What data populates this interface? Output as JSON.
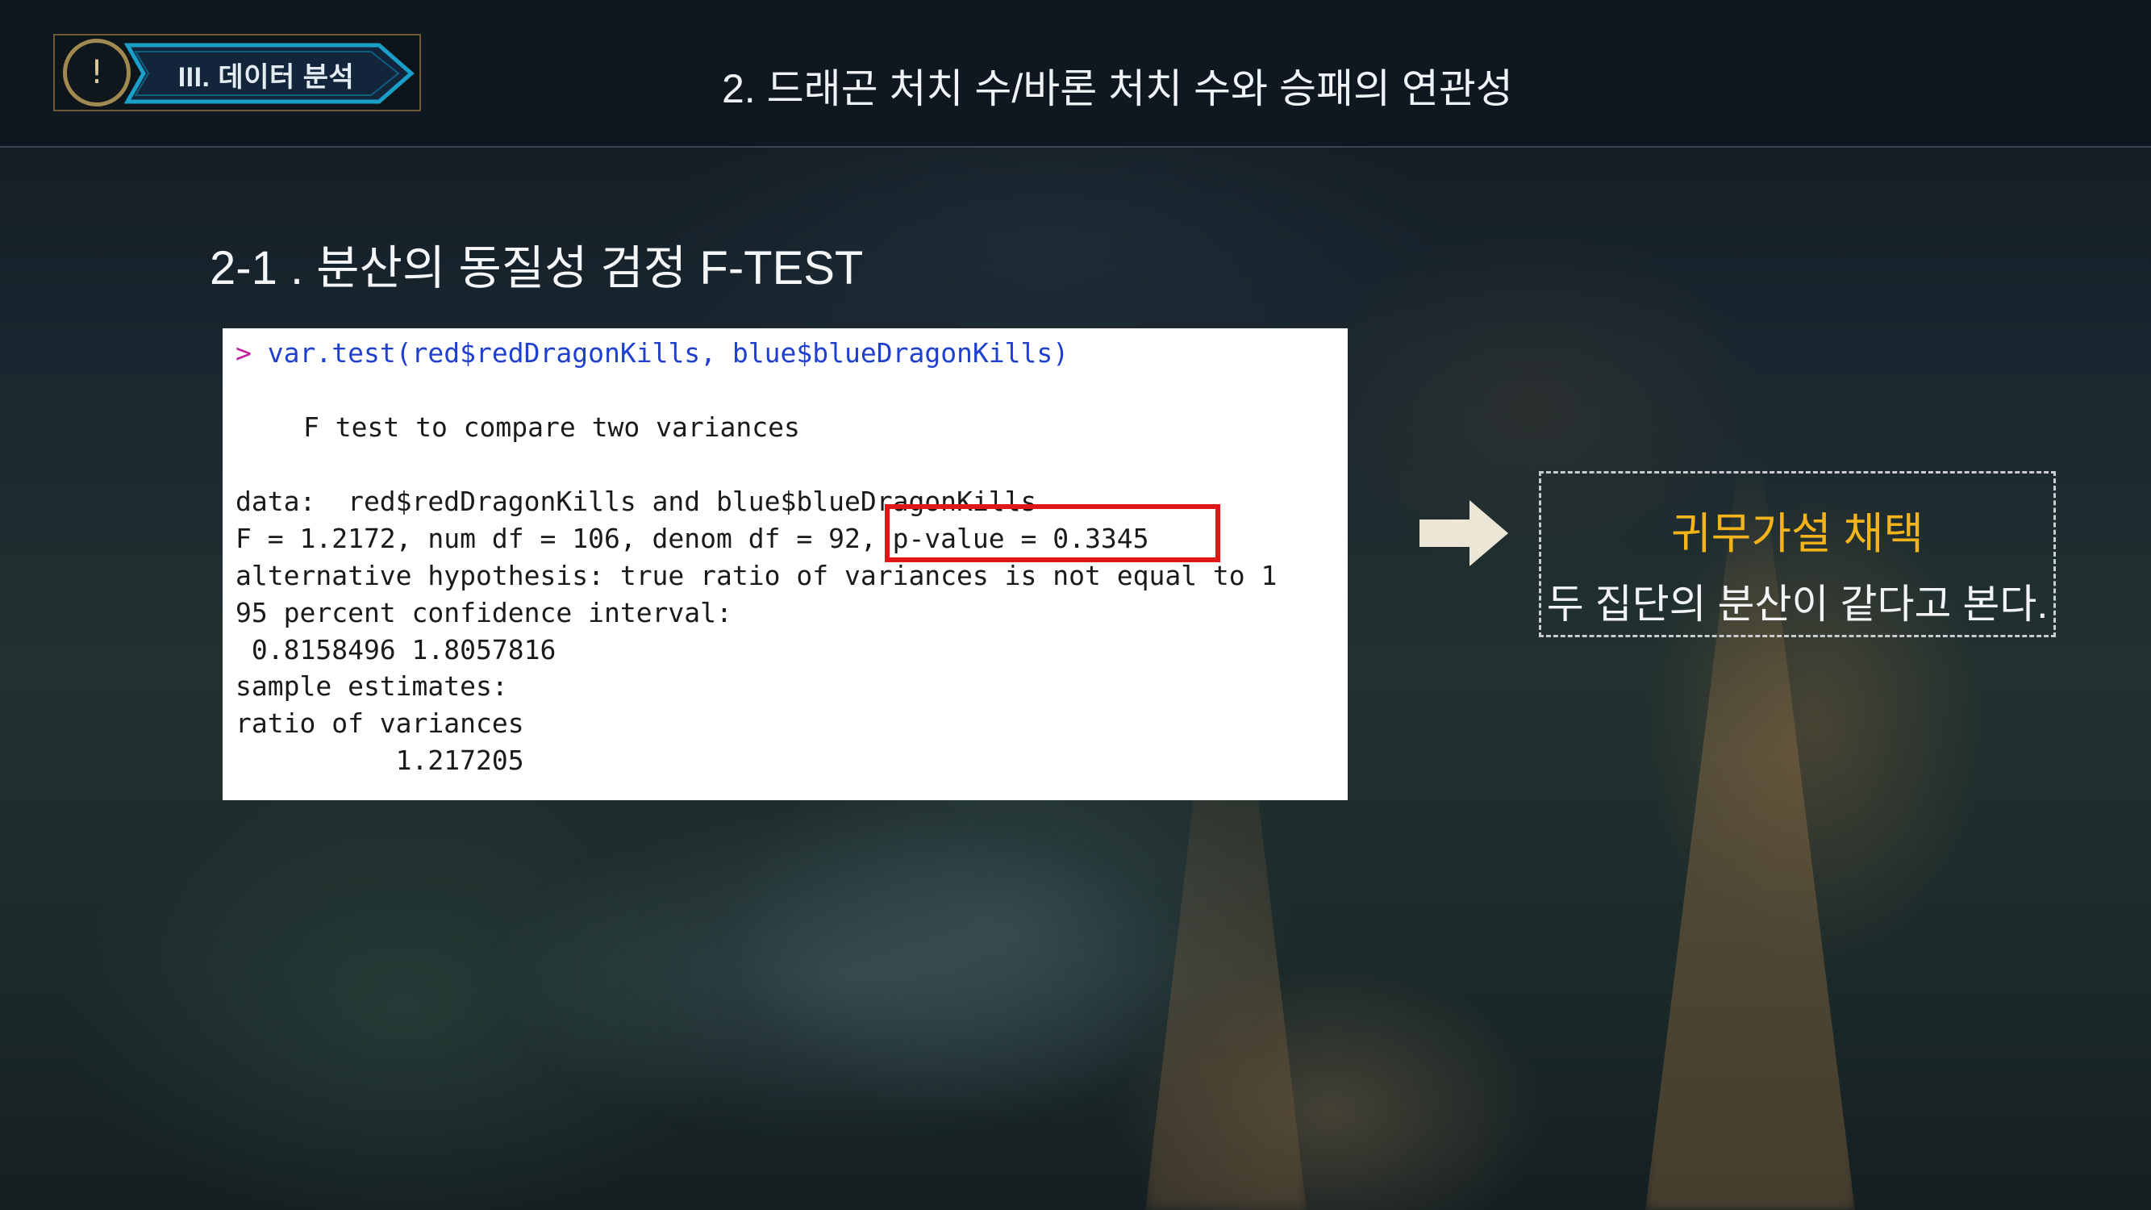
{
  "header": {
    "badge_icon": "exclamation-icon",
    "badge_label": "III. 데이터 분석",
    "title": "2. 드래곤 처치 수/바론 처치 수와 승패의 연관성"
  },
  "section": {
    "heading": "2-1 . 분산의 동질성 검정 F-TEST"
  },
  "console": {
    "prompt": ">",
    "command": "var.test(red$redDragonKills, blue$blueDragonKills)",
    "lines": [
      "F test to compare two variances",
      "data:  red$redDragonKills and blue$blueDragonKills",
      "F = 1.2172, num df = 106, denom df = 92, p-value = 0.3345",
      "alternative hypothesis: true ratio of variances is not equal to 1",
      "95 percent confidence interval:",
      " 0.8158496 1.8057816",
      "sample estimates:",
      "ratio of variances",
      "          1.217205"
    ],
    "highlighted": "p-value = 0.3345"
  },
  "conclusion": {
    "arrow_icon": "right-arrow-icon",
    "title": "귀무가설 채택",
    "body": "두 집단의 분산이 같다고 본다."
  },
  "colors": {
    "highlight_border": "#e01717",
    "conclusion_title": "#f2b41a",
    "command_text": "#1f3fd0",
    "prompt": "#c01fa0"
  }
}
